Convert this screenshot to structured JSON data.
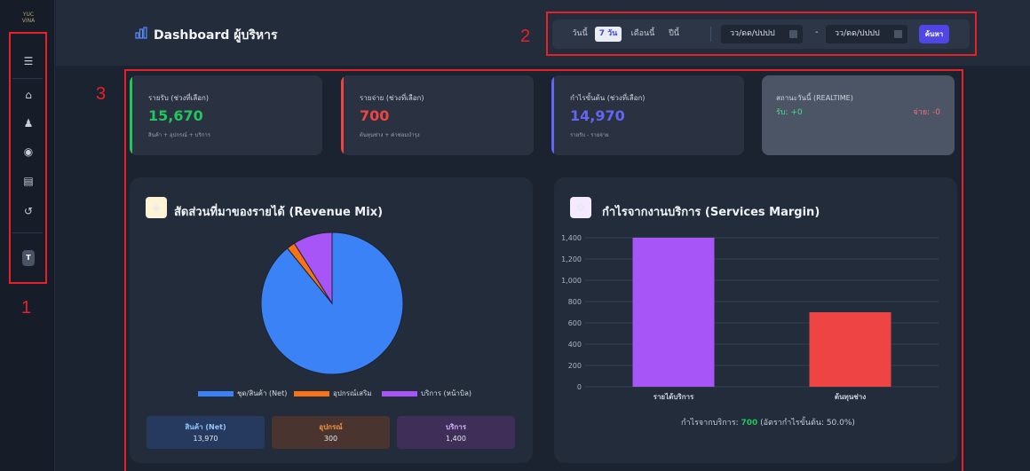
{
  "sidebar": {
    "logo_text": "YUC VINA",
    "icons": [
      "menu-icon",
      "home-icon",
      "users-icon",
      "box-icon",
      "briefcase-icon",
      "history-icon"
    ],
    "avatar_letter": "T"
  },
  "annotations": {
    "n1": "1",
    "n2": "2",
    "n3": "3"
  },
  "header": {
    "title": "Dashboard ผู้บริหาร",
    "filters": {
      "today": "วันนี้",
      "seven_days": "7 วัน",
      "month": "เดือนนี้",
      "year": "ปีนี้"
    },
    "date_from_placeholder": "วว/ดด/ปปปป",
    "date_to_placeholder": "วว/ดด/ปปปป",
    "separator": "-",
    "search_label": "ค้นหา"
  },
  "stats": [
    {
      "label": "รายรับ (ช่วงที่เลือก)",
      "value": "15,670",
      "sub": "สินค้า + อุปกรณ์ + บริการ",
      "color": "#22c55e"
    },
    {
      "label": "รายจ่าย (ช่วงที่เลือก)",
      "value": "700",
      "sub": "ต้นทุนช่าง + ค่าซ่อมบำรุง",
      "color": "#ef4444"
    },
    {
      "label": "กำไรขั้นต้น (ช่วงที่เลือก)",
      "value": "14,970",
      "sub": "รายรับ - รายจ่าย",
      "color": "#6366f1"
    }
  ],
  "realtime": {
    "label": "สถานะวันนี้ (REALTIME)",
    "in_label": "รับ: +0",
    "out_label": "จ่าย: -0"
  },
  "revenue_mix": {
    "title": "สัดส่วนที่มาของรายได้ (Revenue Mix)",
    "legend": [
      "ชุด/สินค้า (Net)",
      "อุปกรณ์เสริม",
      "บริการ (หน้าบิล)"
    ],
    "boxes": [
      {
        "label": "สินค้า (Net)",
        "value": "13,970"
      },
      {
        "label": "อุปกรณ์",
        "value": "300"
      },
      {
        "label": "บริการ",
        "value": "1,400"
      }
    ]
  },
  "services_margin": {
    "title": "กำไรจากงานบริการ (Services Margin)",
    "summary_prefix": "กำไรจากบริการ: ",
    "summary_value": "700",
    "summary_suffix": " (อัตรากำไรขั้นต้น: 50.0%)"
  },
  "chart_data": [
    {
      "type": "pie",
      "categories": [
        "ชุด/สินค้า (Net)",
        "อุปกรณ์เสริม",
        "บริการ (หน้าบิล)"
      ],
      "values": [
        13970,
        300,
        1400
      ],
      "colors": [
        "#3b82f6",
        "#f97316",
        "#a855f7"
      ]
    },
    {
      "type": "bar",
      "categories": [
        "รายได้บริการ",
        "ต้นทุนช่าง"
      ],
      "values": [
        1400,
        700
      ],
      "colors": [
        "#a855f7",
        "#ef4444"
      ],
      "yticks": [
        "0",
        "200",
        "400",
        "600",
        "800",
        "1,000",
        "1,200",
        "1,400"
      ],
      "ylim": [
        0,
        1400
      ],
      "grid": true
    }
  ]
}
